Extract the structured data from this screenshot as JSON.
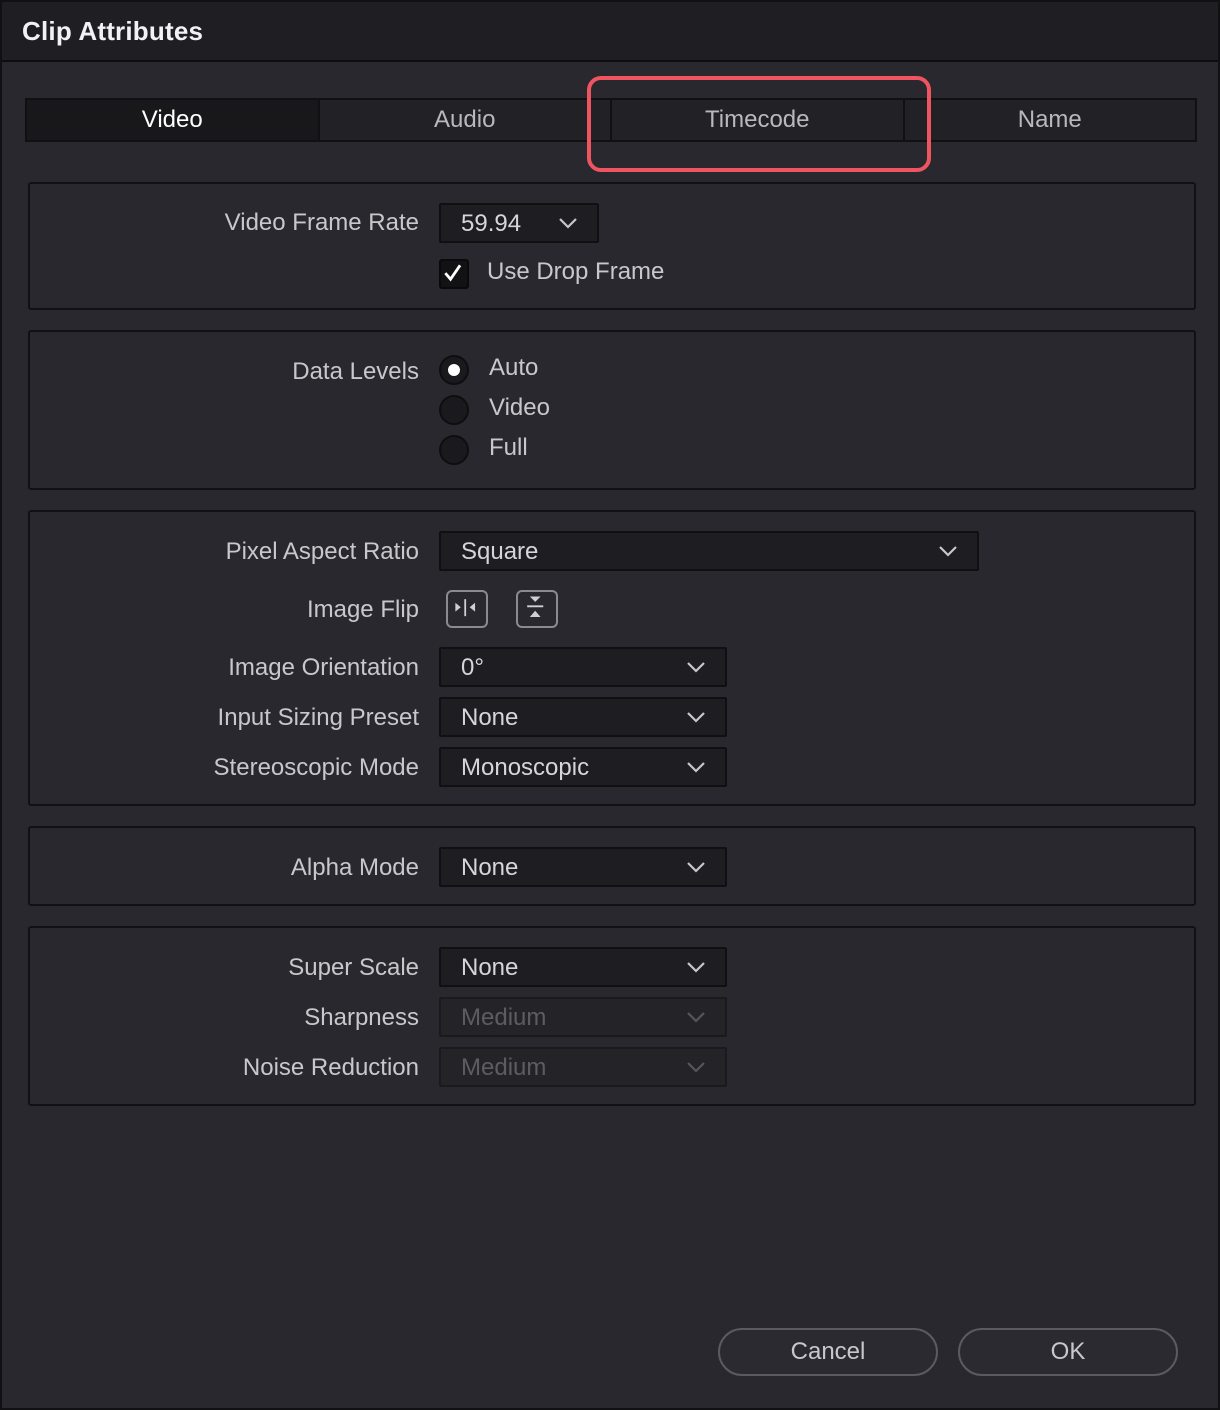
{
  "window": {
    "title": "Clip Attributes"
  },
  "tabs": [
    {
      "label": "Video",
      "active": true
    },
    {
      "label": "Audio",
      "active": false
    },
    {
      "label": "Timecode",
      "active": false
    },
    {
      "label": "Name",
      "active": false
    }
  ],
  "frame_rate": {
    "label": "Video Frame Rate",
    "value": "59.94",
    "drop_frame_label": "Use Drop Frame",
    "drop_frame_checked": true
  },
  "data_levels": {
    "label": "Data Levels",
    "options": [
      "Auto",
      "Video",
      "Full"
    ],
    "selected": "Auto"
  },
  "image": {
    "pixel_aspect_label": "Pixel Aspect Ratio",
    "pixel_aspect_value": "Square",
    "image_flip_label": "Image Flip",
    "orientation_label": "Image Orientation",
    "orientation_value": "0°",
    "sizing_label": "Input Sizing Preset",
    "sizing_value": "None",
    "stereo_label": "Stereoscopic Mode",
    "stereo_value": "Monoscopic"
  },
  "alpha": {
    "label": "Alpha Mode",
    "value": "None"
  },
  "super_scale": {
    "label": "Super Scale",
    "value": "None",
    "sharpness_label": "Sharpness",
    "sharpness_value": "Medium",
    "noise_label": "Noise Reduction",
    "noise_value": "Medium"
  },
  "buttons": {
    "cancel": "Cancel",
    "ok": "OK"
  },
  "colors": {
    "highlight": "#ef5561",
    "background": "#28282e",
    "titlebar": "#1f1f23"
  }
}
